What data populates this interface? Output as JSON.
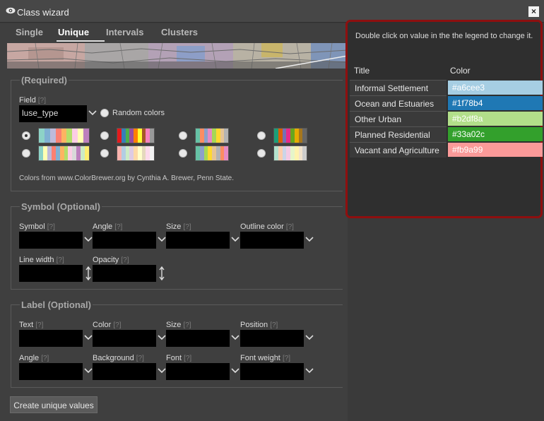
{
  "window": {
    "title": "Class wizard",
    "close_label": "×"
  },
  "tabs": [
    {
      "label": "Single"
    },
    {
      "label": "Unique"
    },
    {
      "label": "Intervals"
    },
    {
      "label": "Clusters"
    }
  ],
  "active_tab": "Unique",
  "required": {
    "legend": "(Required)",
    "field_label": "Field",
    "help": "[?]",
    "field_value": "luse_type",
    "random_colors_label": "Random colors",
    "credit": "Colors from www.ColorBrewer.org by Cynthia A. Brewer, Penn State.",
    "palettes": [
      [
        "#8dd3c7",
        "#80b1d3",
        "#bebada",
        "#fb8072",
        "#fdb462",
        "#b3de69",
        "#fccde5",
        "#ffffb3",
        "#bc80bd"
      ],
      [
        "#e41a1c",
        "#377eb8",
        "#4daf4a",
        "#984ea3",
        "#ff7f00",
        "#ffff33",
        "#a65628",
        "#f781bf",
        "#999999"
      ],
      [
        "#66c2a5",
        "#fc8d62",
        "#8da0cb",
        "#e78ac3",
        "#a6d854",
        "#ffd92f",
        "#e5c494",
        "#b3b3b3"
      ],
      [
        "#1b9e77",
        "#d95f02",
        "#7570b3",
        "#e7298a",
        "#66a61e",
        "#e6ab02",
        "#a6761d",
        "#666666"
      ],
      [
        "#8dd3c7",
        "#ffffb3",
        "#bebada",
        "#fb8072",
        "#80b1d3",
        "#fdb462",
        "#b3de69",
        "#fccde5",
        "#d9d9d9",
        "#bc80bd",
        "#ccebc5",
        "#ffed6f"
      ],
      [
        "#fbb4ae",
        "#b3cde3",
        "#ccebc5",
        "#decbe4",
        "#fed9a6",
        "#ffffcc",
        "#e5d8bd",
        "#fddaec",
        "#f2f2f2"
      ],
      [
        "#66c2a5",
        "#8da0cb",
        "#a6d854",
        "#ffd92f",
        "#e5c494",
        "#b3b3b3",
        "#fc8d62",
        "#e78ac3"
      ],
      [
        "#b3e2cd",
        "#fdcdac",
        "#cbd5e8",
        "#f4cae4",
        "#e6f5c9",
        "#fff2ae",
        "#f1e2cc",
        "#cccccc"
      ]
    ],
    "selected_palette": 0
  },
  "symbol": {
    "legend": "Symbol (Optional)",
    "fields": [
      {
        "label": "Symbol",
        "help": "[?]"
      },
      {
        "label": "Angle",
        "help": "[?]"
      },
      {
        "label": "Size",
        "help": "[?]"
      },
      {
        "label": "Outline color",
        "help": "[?]"
      },
      {
        "label": "Line width",
        "help": "[?]"
      },
      {
        "label": "Opacity",
        "help": "[?]"
      }
    ]
  },
  "label_section": {
    "legend": "Label (Optional)",
    "fields": [
      {
        "label": "Text",
        "help": "[?]"
      },
      {
        "label": "Color",
        "help": "[?]"
      },
      {
        "label": "Size",
        "help": "[?]"
      },
      {
        "label": "Position",
        "help": "[?]"
      },
      {
        "label": "Angle",
        "help": "[?]"
      },
      {
        "label": "Background",
        "help": "[?]"
      },
      {
        "label": "Font",
        "help": "[?]"
      },
      {
        "label": "Font weight",
        "help": "[?]"
      }
    ]
  },
  "create_button": "Create unique values",
  "legend_panel": {
    "hint": "Double click on value in the the legend to change it.",
    "col_title": "Title",
    "col_color": "Color",
    "rows": [
      {
        "title": "Informal Settlement",
        "color": "#a6cee3"
      },
      {
        "title": "Ocean and Estuaries",
        "color": "#1f78b4"
      },
      {
        "title": "Other Urban",
        "color": "#b2df8a"
      },
      {
        "title": "Planned Residential",
        "color": "#33a02c"
      },
      {
        "title": "Vacant and Agriculture",
        "color": "#fb9a99"
      }
    ]
  },
  "colors": {
    "highlight_border": "#8e0f0f",
    "background": "#3a3a3a"
  }
}
